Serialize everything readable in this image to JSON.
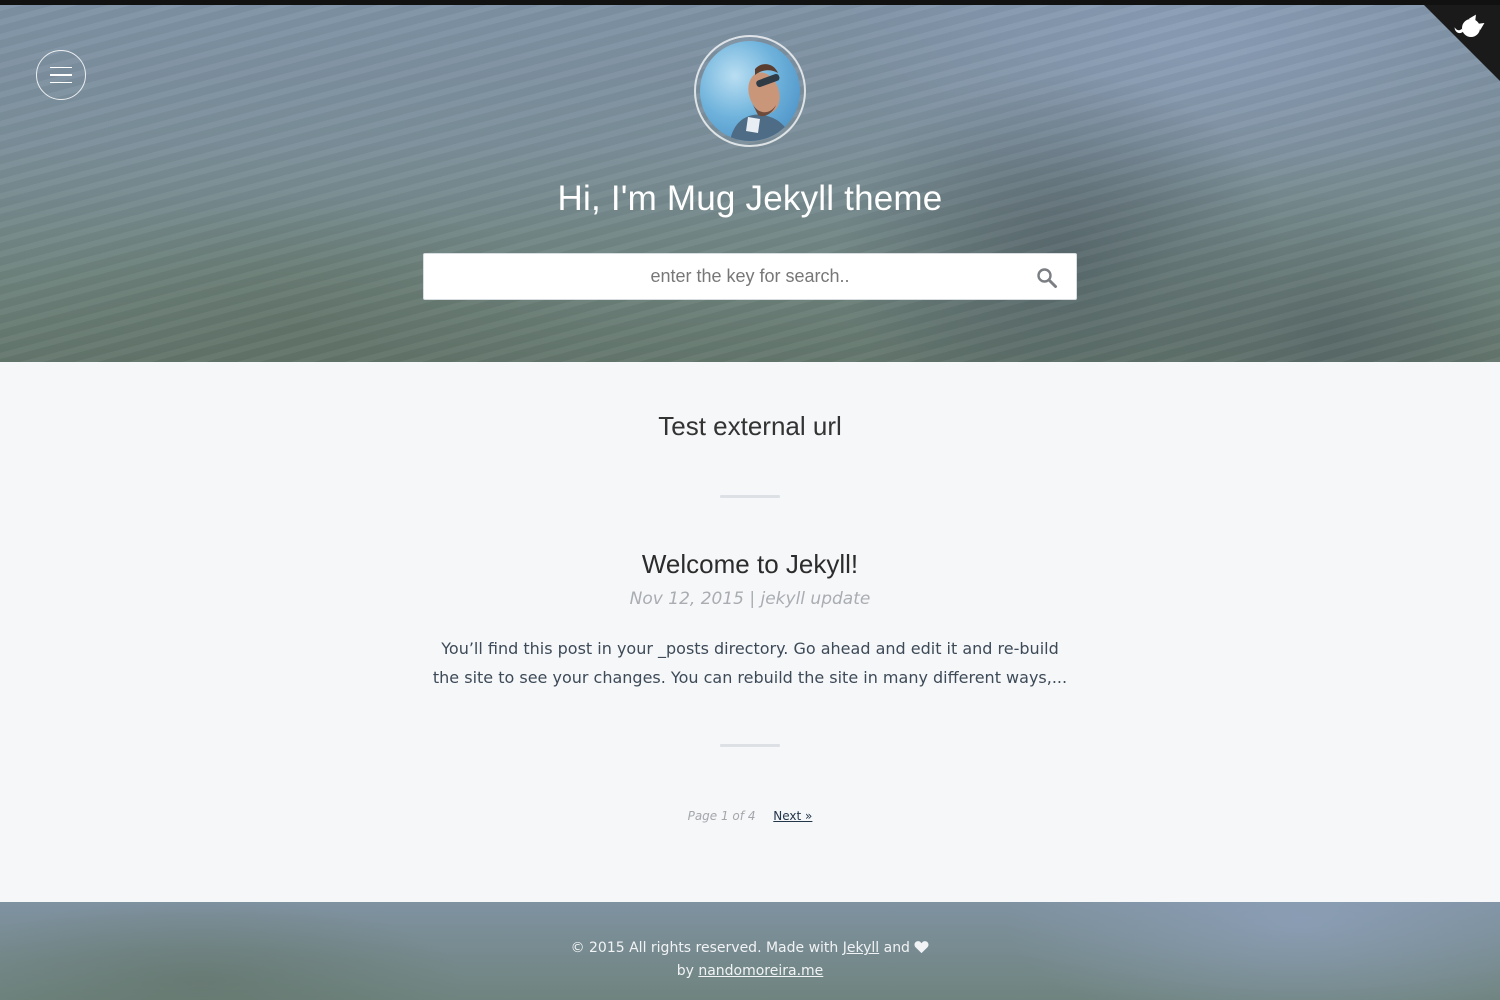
{
  "header": {
    "site_title": "Hi, I'm Mug Jekyll theme",
    "search": {
      "placeholder": "enter the key for search.."
    },
    "icons": {
      "menu": "hamburger-menu-icon",
      "github": "github-octocat-icon",
      "search": "search-icon"
    }
  },
  "posts": [
    {
      "title": "Test external url"
    },
    {
      "title": "Welcome to Jekyll!",
      "meta": "Nov 12, 2015 | jekyll update",
      "excerpt": "You’ll find this post in your _posts directory. Go ahead and edit it and re-build the site to see your changes. You can rebuild the site in many different ways,..."
    }
  ],
  "pagination": {
    "page_info": "Page 1 of 4",
    "next_label": "Next »"
  },
  "footer": {
    "copyright_text": "© 2015 All rights reserved. Made with",
    "jekyll_link": "Jekyll",
    "and_text": "and",
    "by_text": "by",
    "author_link": "nandomoreira.me"
  },
  "colors": {
    "background": "#f6f7f9",
    "text_dark": "#2c2c2c",
    "meta_gray": "#a9adb1",
    "link_dark": "#23364a"
  }
}
